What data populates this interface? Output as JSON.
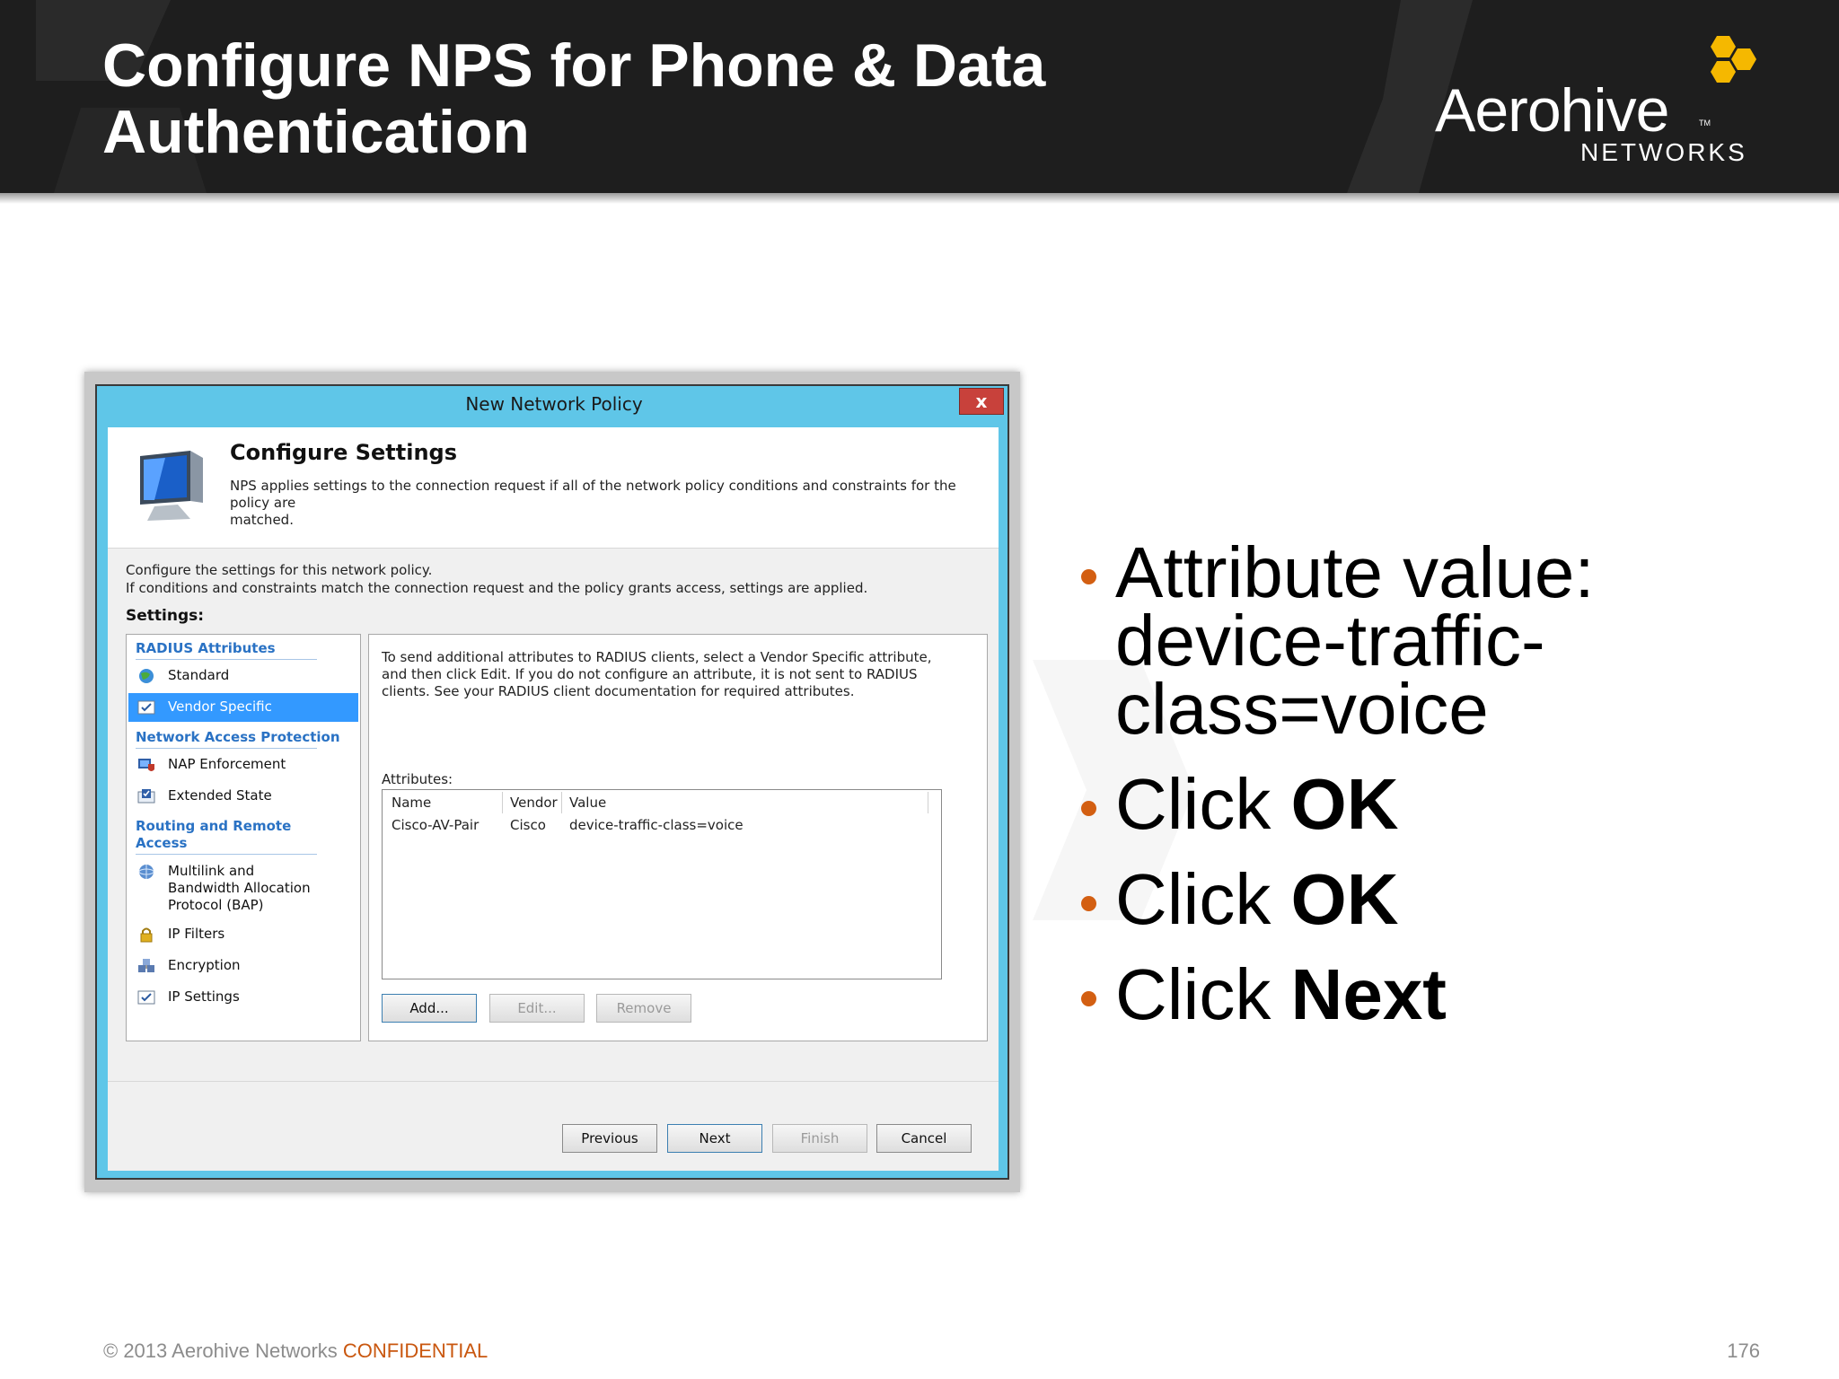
{
  "slide": {
    "title_line1": "Configure NPS for Phone & Data",
    "title_line2": "Authentication",
    "logo_word": "Aerohive",
    "logo_sub": "NETWORKS",
    "logo_tm": "TM",
    "footer_copyright": "© 2013 Aerohive Networks ",
    "footer_confidential": "CONFIDENTIAL",
    "page_number": "176",
    "colors": {
      "banner": "#1e1e1e",
      "accent_bullet": "#d35f12",
      "logo_hex": "#f5b800",
      "confidential": "#c9570f"
    }
  },
  "bullets": [
    {
      "text": "Attribute value: device-traffic-class=voice",
      "bold": ""
    },
    {
      "text": "Click ",
      "bold": "OK"
    },
    {
      "text": "Click ",
      "bold": "OK"
    },
    {
      "text": "Click ",
      "bold": "Next"
    }
  ],
  "dialog": {
    "title": "New Network Policy",
    "close_label": "x",
    "header_title": "Configure Settings",
    "header_desc": "NPS applies settings to the connection request if all of the network policy conditions and constraints for the policy are\nmatched.",
    "intro_line1": "Configure the settings for this network policy.",
    "intro_line2": "If conditions and constraints match the connection request and the policy grants access, settings are applied.",
    "settings_label": "Settings:",
    "categories": {
      "radius": "RADIUS Attributes",
      "nap": "Network Access Protection",
      "routing": "Routing and Remote\nAccess"
    },
    "nav_items": {
      "standard": {
        "label": "Standard",
        "icon": "globe-icon"
      },
      "vendor_specific": {
        "label": "Vendor Specific",
        "icon": "checkbox-icon"
      },
      "nap_enforcement": {
        "label": "NAP Enforcement",
        "icon": "nap-shield-icon"
      },
      "extended_state": {
        "label": "Extended State",
        "icon": "extended-state-icon"
      },
      "multilink": {
        "label": "Multilink and\nBandwidth Allocation\nProtocol (BAP)",
        "icon": "network-globe-icon"
      },
      "ip_filters": {
        "label": "IP Filters",
        "icon": "lock-icon"
      },
      "encryption": {
        "label": "Encryption",
        "icon": "encryption-icon"
      },
      "ip_settings": {
        "label": "IP Settings",
        "icon": "checkbox-icon"
      }
    },
    "right_desc": "To send additional attributes to RADIUS clients, select a Vendor Specific attribute, and then click Edit. If you do not configure an attribute, it is not sent to RADIUS clients. See your RADIUS client documentation for required attributes.",
    "attributes_label": "Attributes:",
    "table": {
      "headers": {
        "name": "Name",
        "vendor": "Vendor",
        "value": "Value"
      },
      "rows": [
        {
          "name": "Cisco-AV-Pair",
          "vendor": "Cisco",
          "value": "device-traffic-class=voice"
        }
      ]
    },
    "buttons": {
      "add": "Add...",
      "edit": "Edit...",
      "remove": "Remove",
      "previous": "Previous",
      "next": "Next",
      "finish": "Finish",
      "cancel": "Cancel"
    }
  }
}
